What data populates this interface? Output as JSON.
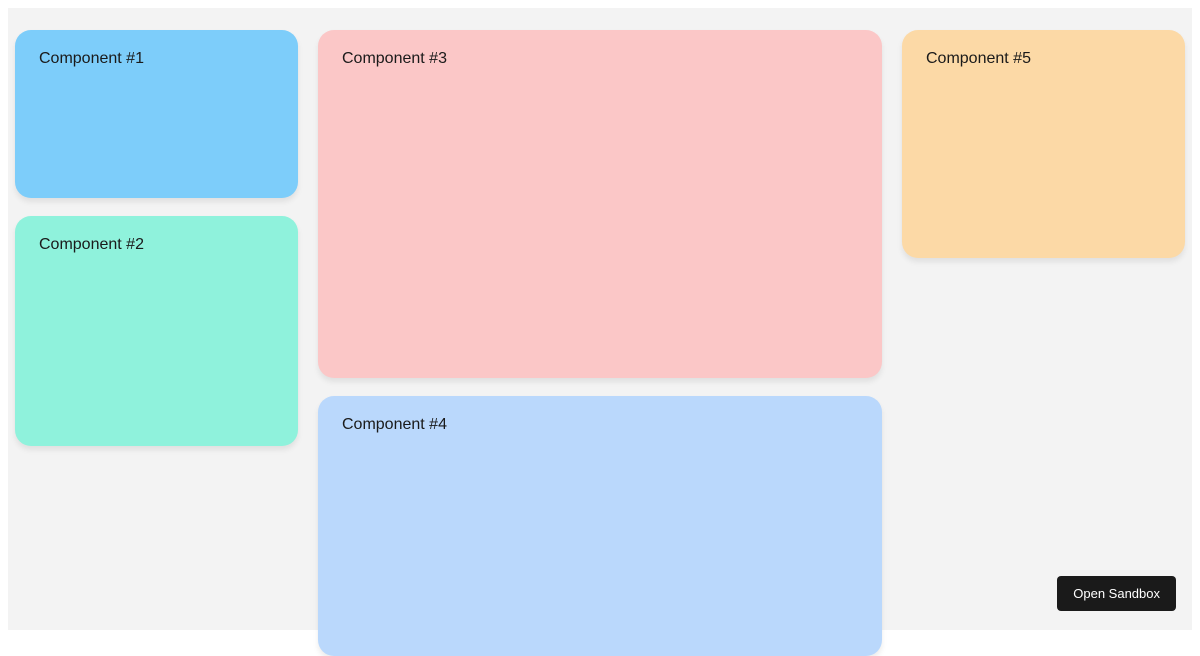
{
  "columns": {
    "left": [
      {
        "label": "Component #1",
        "color": "#7dcdfa"
      },
      {
        "label": "Component #2",
        "color": "#8ff2dc"
      }
    ],
    "mid": [
      {
        "label": "Component #3",
        "color": "#fbc7c7"
      },
      {
        "label": "Component #4",
        "color": "#bad8fc"
      }
    ],
    "right": [
      {
        "label": "Component #5",
        "color": "#fcd9a6"
      }
    ]
  },
  "actions": {
    "open_sandbox": "Open Sandbox"
  }
}
